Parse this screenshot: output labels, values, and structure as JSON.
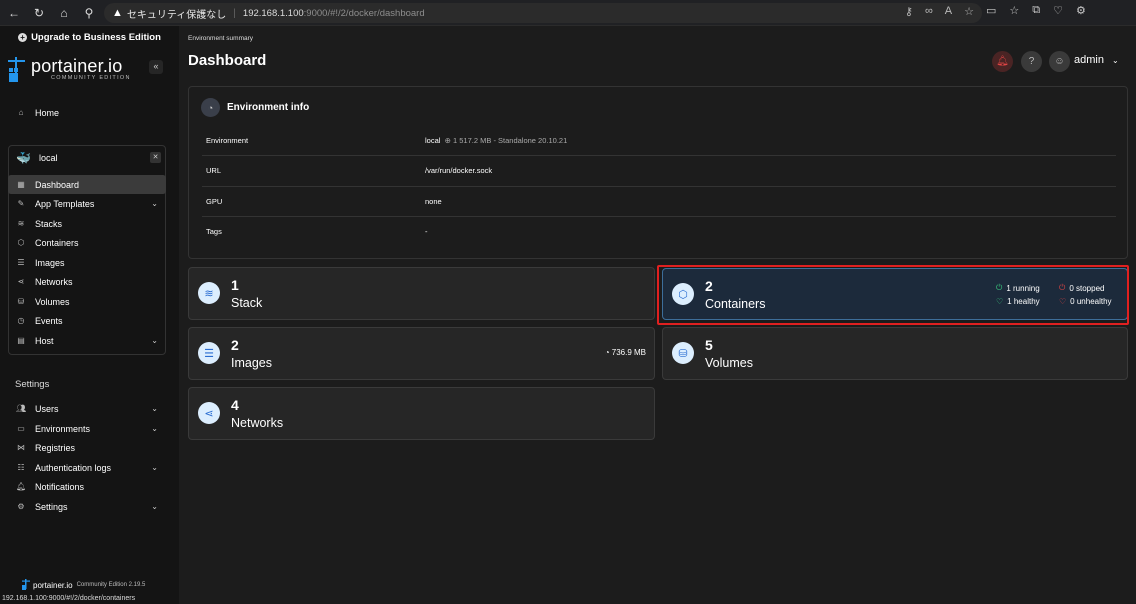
{
  "browser": {
    "insecure_label": "セキュリティ保護なし",
    "url_host": "192.168.1.100",
    "url_rest": ":9000/#!/2/docker/dashboard"
  },
  "sidebar": {
    "upgrade_label": "Upgrade to Business Edition",
    "logo_name": "portainer.io",
    "logo_sub": "COMMUNITY EDITION",
    "home_label": "Home",
    "environment_name": "local",
    "env_items": [
      {
        "label": "Dashboard",
        "icon": "dashboard-icon"
      },
      {
        "label": "App Templates",
        "icon": "edit-icon"
      },
      {
        "label": "Stacks",
        "icon": "layers-icon"
      },
      {
        "label": "Containers",
        "icon": "box-icon"
      },
      {
        "label": "Images",
        "icon": "list-icon"
      },
      {
        "label": "Networks",
        "icon": "share-icon"
      },
      {
        "label": "Volumes",
        "icon": "database-icon"
      },
      {
        "label": "Events",
        "icon": "history-icon"
      },
      {
        "label": "Host",
        "icon": "host-icon"
      }
    ],
    "settings_title": "Settings",
    "settings_items": [
      {
        "label": "Users",
        "icon": "users-icon"
      },
      {
        "label": "Environments",
        "icon": "environments-icon"
      },
      {
        "label": "Registries",
        "icon": "registries-icon"
      },
      {
        "label": "Authentication logs",
        "icon": "auth-logs-icon"
      },
      {
        "label": "Notifications",
        "icon": "bell-icon"
      },
      {
        "label": "Settings",
        "icon": "gear-icon"
      }
    ],
    "footer_name": "portainer.io",
    "footer_version": "Community Edition 2.19.5",
    "status_url": "192.168.1.100:9000/#!/2/docker/containers"
  },
  "main": {
    "breadcrumb": "Environment summary",
    "title": "Dashboard",
    "user": "admin",
    "env_info": {
      "title": "Environment info",
      "rows": [
        {
          "key": "Environment",
          "value": "local",
          "extra": "1  517.2 MB - Standalone 20.10.21"
        },
        {
          "key": "URL",
          "value": "/var/run/docker.sock"
        },
        {
          "key": "GPU",
          "value": "none"
        },
        {
          "key": "Tags",
          "value": "-"
        }
      ]
    },
    "tiles": {
      "stack": {
        "num": "1",
        "label": "Stack"
      },
      "containers": {
        "num": "2",
        "label": "Containers",
        "running": "1 running",
        "stopped": "0 stopped",
        "healthy": "1 healthy",
        "unhealthy": "0 unhealthy"
      },
      "images": {
        "num": "2",
        "label": "Images",
        "size": "736.9 MB"
      },
      "volumes": {
        "num": "5",
        "label": "Volumes"
      },
      "networks": {
        "num": "4",
        "label": "Networks"
      }
    }
  },
  "colors": {
    "accent_blue": "#2496ed",
    "running_green": "#3bcf80",
    "stopped_red": "#e04545",
    "highlight_border": "#e02020"
  }
}
